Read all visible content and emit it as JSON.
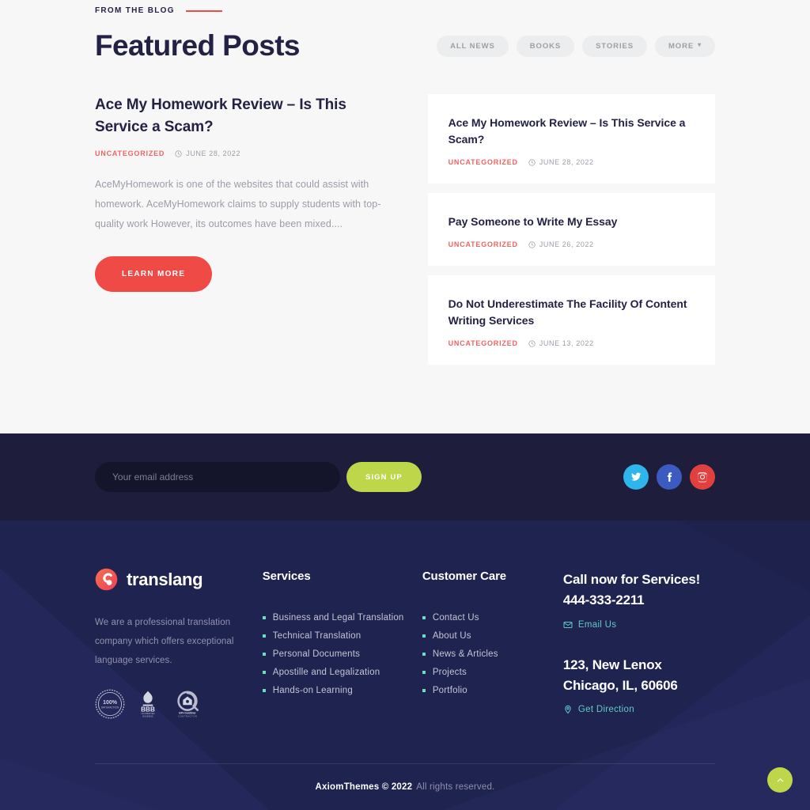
{
  "blog": {
    "eyebrow": "FROM THE BLOG",
    "title": "Featured Posts",
    "filters": [
      {
        "label": "ALL NEWS",
        "has_chevron": false
      },
      {
        "label": "BOOKS",
        "has_chevron": false
      },
      {
        "label": "STORIES",
        "has_chevron": false
      },
      {
        "label": "MORE",
        "has_chevron": true
      }
    ],
    "featured": {
      "title": "Ace My Homework Review – Is This Service a Scam?",
      "category": "UNCATEGORIZED",
      "date": "JUNE 28, 2022",
      "excerpt": "AceMyHomework is one of the websites that could assist with homework. AceMyHomework claims to supply students with top-quality work However, its outcomes have been mixed....",
      "cta_label": "LEARN MORE"
    },
    "cards": [
      {
        "title": "Ace My Homework Review – Is This Service a Scam?",
        "category": "UNCATEGORIZED",
        "date": "JUNE 28, 2022"
      },
      {
        "title": "Pay Someone to Write My Essay",
        "category": "UNCATEGORIZED",
        "date": "JUNE 26, 2022"
      },
      {
        "title": "Do Not Underestimate The Facility Of Content Writing Services",
        "category": "UNCATEGORIZED",
        "date": "JUNE 13, 2022"
      }
    ]
  },
  "newsletter": {
    "email_placeholder": "Your email address",
    "email_value": "",
    "signup_label": "SIGN UP",
    "socials": [
      {
        "name": "twitter",
        "color": "#2eb5ec"
      },
      {
        "name": "facebook",
        "color": "#3b5bc0"
      },
      {
        "name": "instagram",
        "color": "#e0403e"
      }
    ]
  },
  "footer": {
    "brand": {
      "name": "translang",
      "description": "We are a professional translation company which offers exceptional language services.",
      "badges": [
        {
          "label": "100% SATISFACTION"
        },
        {
          "label": "BBB ACCREDITED BUSINESS"
        },
        {
          "label": "BPI GoldStar CONTRACTOR"
        }
      ]
    },
    "services": {
      "title": "Services",
      "items": [
        "Business and Legal Translation",
        "Technical Translation",
        "Personal Documents",
        "Apostille and Legalization",
        "Hands-on Learning"
      ]
    },
    "customer_care": {
      "title": "Customer Care",
      "items": [
        "Contact Us",
        "About Us",
        "News & Articles",
        "Projects",
        "Portfolio"
      ]
    },
    "contact": {
      "call_line1": "Call now for Services!",
      "call_line2": "444-333-2211",
      "email_label": "Email Us",
      "address_line1": "123, New Lenox",
      "address_line2": "Chicago, IL, 60606",
      "direction_label": "Get Direction"
    },
    "copyright_strong": "AxiomThemes © 2022",
    "copyright_rest": "All rights reserved."
  },
  "colors": {
    "accent_red": "#ef4a46",
    "accent_green": "#bdd64a",
    "navy": "#232244",
    "footer_navy": "#1f2350",
    "newsletter_navy": "#1e1e3c",
    "teal": "#62c9c7",
    "bullet_green": "#6fdcc0"
  },
  "to_top": {
    "icon": "chevron-up-icon"
  }
}
